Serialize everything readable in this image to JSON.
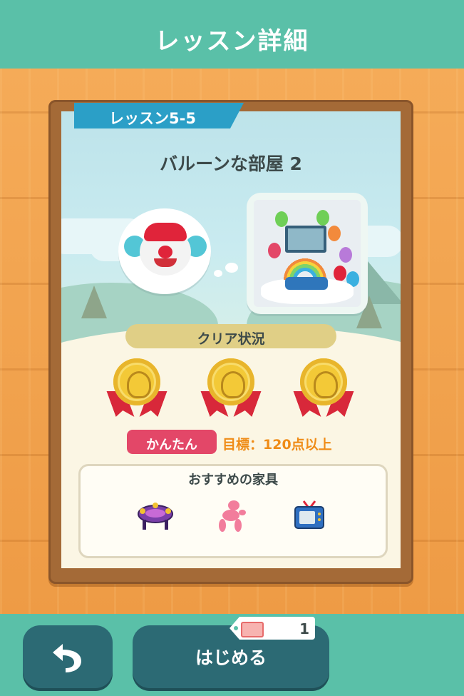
{
  "header": {
    "title": "レッスン詳細"
  },
  "lesson": {
    "number_label": "レッスン5-5",
    "room_name": "バルーンな部屋 2"
  },
  "clear_status": {
    "label": "クリア状況",
    "medals": [
      "gold-medal-icon",
      "gold-medal-icon",
      "gold-medal-icon"
    ]
  },
  "difficulty": {
    "label": "かんたん",
    "goal": "目標：120点以上",
    "badge_color": "#e34768",
    "goal_color": "#ef8c17"
  },
  "recommended": {
    "title": "おすすめの家具",
    "items": [
      "purple-table-icon",
      "pink-balloon-animal-icon",
      "blue-tv-icon"
    ]
  },
  "footer": {
    "back_icon": "undo-arrow-icon",
    "start_label": "はじめる",
    "ticket_count": "1"
  },
  "colors": {
    "header": "#5ac0a8",
    "button": "#2c6a74",
    "ribbon": "#2b9fc7"
  }
}
